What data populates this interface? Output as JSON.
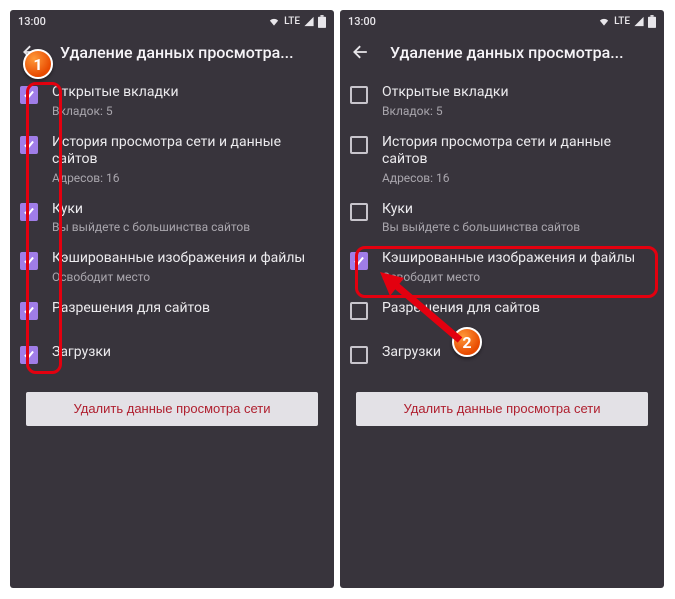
{
  "status": {
    "time": "13:00",
    "net": "LTE"
  },
  "page_title": "Удаление данных просмотра...",
  "delete_button": "Удалить данные просмотра сети",
  "left": {
    "items": [
      {
        "label": "Открытые вкладки",
        "sub": "Вкладок: 5",
        "checked": true
      },
      {
        "label": "История просмотра сети и данные сайтов",
        "sub": "Адресов: 16",
        "checked": true
      },
      {
        "label": "Куки",
        "sub": "Вы выйдете с большинства сайтов",
        "checked": true
      },
      {
        "label": "Кэшированные изображения и файлы",
        "sub": "Освободит место",
        "checked": true
      },
      {
        "label": "Разрешения для сайтов",
        "sub": "",
        "checked": true
      },
      {
        "label": "Загрузки",
        "sub": "",
        "checked": true
      }
    ]
  },
  "right": {
    "items": [
      {
        "label": "Открытые вкладки",
        "sub": "Вкладок: 5",
        "checked": false
      },
      {
        "label": "История просмотра сети и данные сайтов",
        "sub": "Адресов: 16",
        "checked": false
      },
      {
        "label": "Куки",
        "sub": "Вы выйдете с большинства сайтов",
        "checked": false
      },
      {
        "label": "Кэшированные изображения и файлы",
        "sub": "Освободит место",
        "checked": true
      },
      {
        "label": "Разрешения для сайтов",
        "sub": "",
        "checked": false
      },
      {
        "label": "Загрузки",
        "sub": "",
        "checked": false
      }
    ]
  },
  "badge1": "1",
  "badge2": "2"
}
